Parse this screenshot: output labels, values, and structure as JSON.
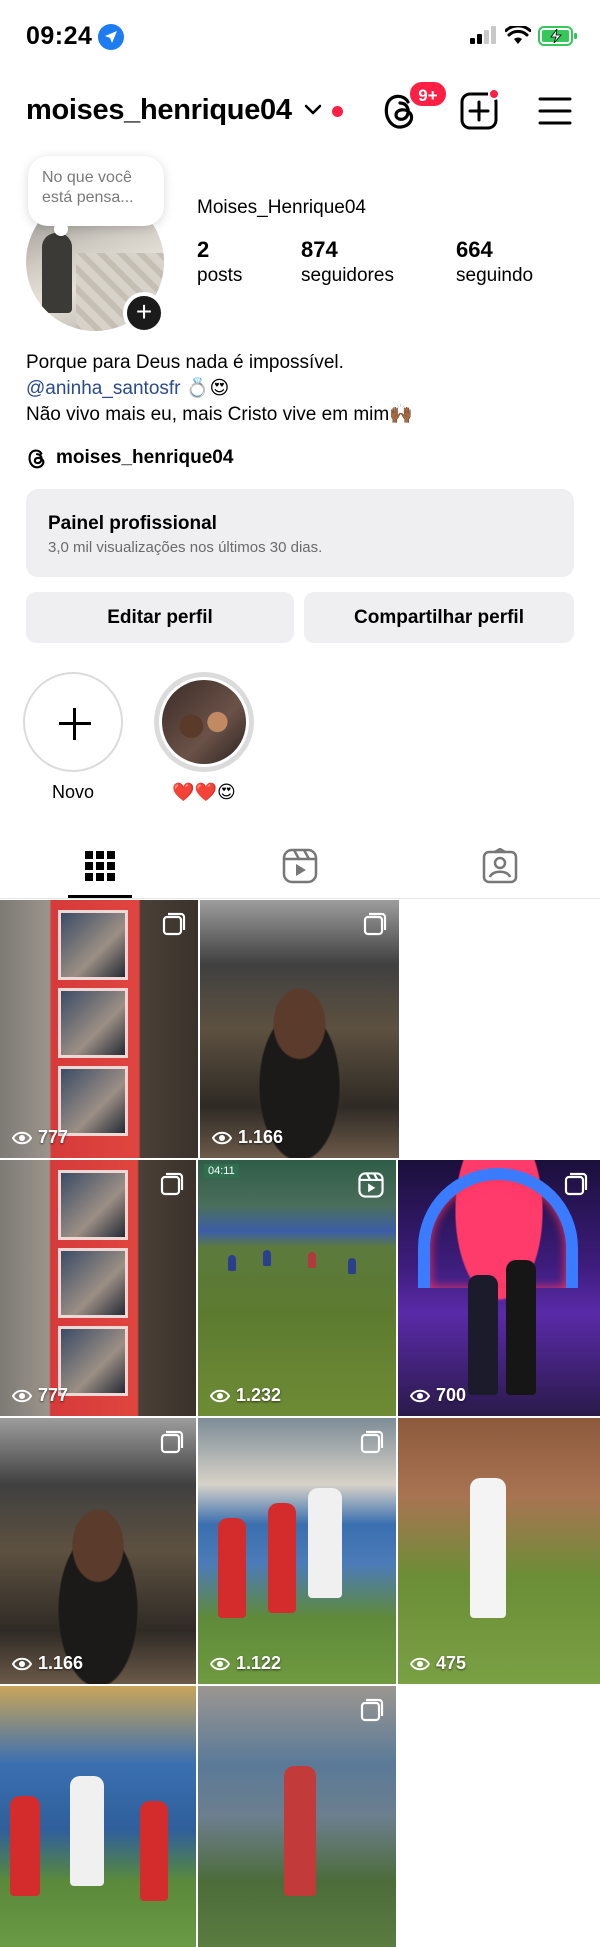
{
  "status_bar": {
    "time": "09:24"
  },
  "header": {
    "username": "moises_henrique04",
    "notification_badge": "9+"
  },
  "profile": {
    "note_placeholder": "No que você está pensa...",
    "display_name": "Moises_Henrique04",
    "stats": [
      {
        "value": "2",
        "label": "posts"
      },
      {
        "value": "874",
        "label": "seguidores"
      },
      {
        "value": "664",
        "label": "seguindo"
      }
    ],
    "bio": {
      "line1": "Porque para Deus nada é impossível.",
      "mention": "@aninha_santosfr",
      "mention_emoji": "💍😍",
      "line3": "Não vivo mais eu, mais Cristo vive em mim🙌🏾"
    },
    "threads_handle": "moises_henrique04"
  },
  "panel": {
    "title": "Painel profissional",
    "subtitle": "3,0 mil visualizações nos últimos 30 dias."
  },
  "actions": {
    "edit": "Editar perfil",
    "share": "Compartilhar perfil"
  },
  "highlights": [
    {
      "label": "Novo"
    },
    {
      "label": "❤️❤️😍"
    }
  ],
  "grid": [
    {
      "views": "777",
      "type": "carousel"
    },
    {
      "views": "1.166",
      "type": "carousel"
    },
    {
      "views": "777",
      "type": "carousel"
    },
    {
      "views": "1.232",
      "type": "reel",
      "timecode": "04:11"
    },
    {
      "views": "700",
      "type": "carousel"
    },
    {
      "views": "1.166",
      "type": "carousel"
    },
    {
      "views": "1.122",
      "type": "carousel"
    },
    {
      "views": "475",
      "type": "none"
    },
    {
      "views": "",
      "type": "none"
    },
    {
      "views": "",
      "type": "carousel"
    }
  ],
  "colors": {
    "notification_red": "#ff1f45",
    "mention_blue": "#2a4a8e",
    "panel_bg": "#efeff1"
  }
}
